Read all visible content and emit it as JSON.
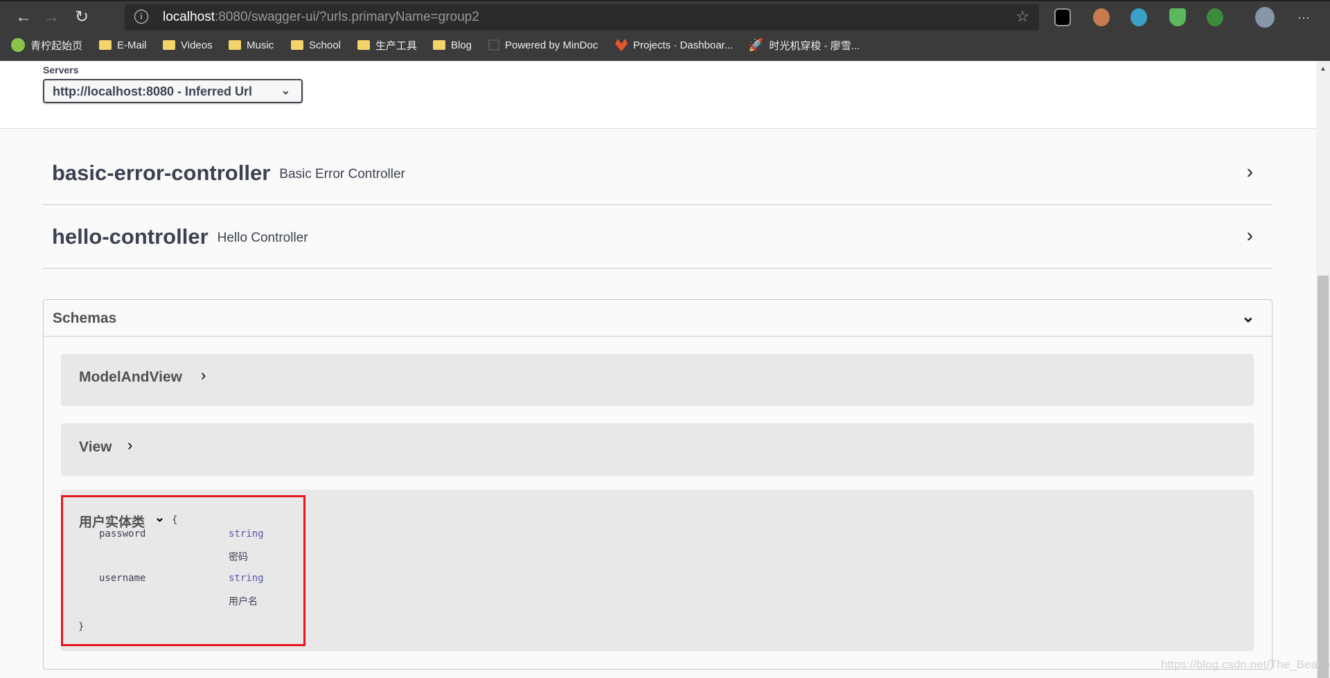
{
  "browser": {
    "url_host": "localhost",
    "url_rest": ":8080/swagger-ui/?urls.primaryName=group2",
    "bookmarks": [
      "青柠起始页",
      "E-Mail",
      "Videos",
      "Music",
      "School",
      "生产工具",
      "Blog",
      "Powered by MinDoc",
      "Projects · Dashboar...",
      "时光机穿梭 - 廖雪..."
    ]
  },
  "servers": {
    "label": "Servers",
    "selected": "http://localhost:8080 - Inferred Url"
  },
  "tags": [
    {
      "name": "basic-error-controller",
      "desc": "Basic Error Controller"
    },
    {
      "name": "hello-controller",
      "desc": "Hello Controller"
    }
  ],
  "schemas": {
    "title": "Schemas",
    "models": [
      "ModelAndView",
      "View"
    ],
    "entity": {
      "name": "用户实体类",
      "open": "{",
      "close": "}",
      "props": [
        {
          "name": "password",
          "type": "string",
          "desc": "密码"
        },
        {
          "name": "username",
          "type": "string",
          "desc": "用户名"
        }
      ]
    }
  },
  "watermark": "https://blog.csdn.net/The_Beacon",
  "colors": {
    "highlight": "#e8131c",
    "type": "#55a"
  }
}
